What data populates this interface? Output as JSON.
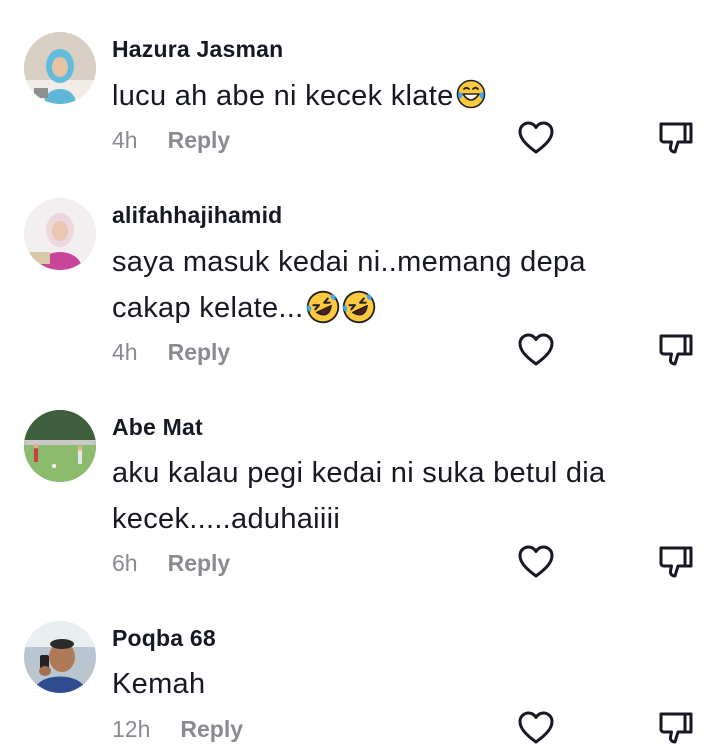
{
  "comments": [
    {
      "avatar_icon": "avatar-hijab-woman",
      "username": "Hazura Jasman",
      "text": "lucu ah abe ni kecek klate",
      "emojis": [
        "laughing-tears-emoji"
      ],
      "time": "4h",
      "reply_label": "Reply"
    },
    {
      "avatar_icon": "avatar-hijab-woman-pink",
      "username": "alifahhajihamid",
      "text": "saya masuk kedai ni..memang depa cakap kelate...",
      "emojis": [
        "rolling-laughing-emoji",
        "rolling-laughing-emoji"
      ],
      "time": "4h",
      "reply_label": "Reply"
    },
    {
      "avatar_icon": "avatar-football-field",
      "username": "Abe Mat",
      "text": "aku kalau pegi kedai ni suka betul dia kecek.....aduhaiiii",
      "emojis": [],
      "time": "6h",
      "reply_label": "Reply"
    },
    {
      "avatar_icon": "avatar-man-phone",
      "username": "Poqba 68",
      "text": "Kemah",
      "emojis": [],
      "time": "12h",
      "reply_label": "Reply"
    }
  ],
  "colors": {
    "text": "#161823",
    "muted": "#8a8b91",
    "background": "#ffffff"
  }
}
